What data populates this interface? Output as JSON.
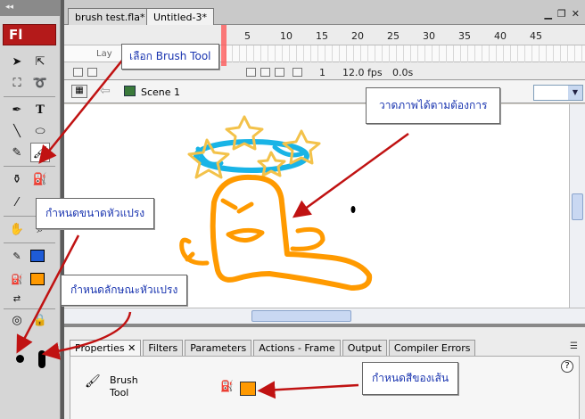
{
  "app": {
    "logo_text": "Fl"
  },
  "document_tabs": [
    {
      "label": "brush test.fla*"
    },
    {
      "label": "Untitled-3*"
    }
  ],
  "timeline": {
    "frame_ticks": [
      "5",
      "10",
      "15",
      "20",
      "25",
      "30",
      "35",
      "40",
      "45"
    ],
    "layer_name": "Lay",
    "current_frame": "1",
    "frame_rate": "12.0 fps",
    "elapsed": "0.0s"
  },
  "scene": {
    "name": "Scene 1"
  },
  "properties": {
    "tabs": [
      "Properties",
      "Filters",
      "Parameters",
      "Actions - Frame",
      "Output",
      "Compiler Errors"
    ],
    "tool_name_line1": "Brush",
    "tool_name_line2": "Tool",
    "help_glyph": "?"
  },
  "colors": {
    "stroke_color": "#1e5bd6",
    "fill_color": "#ff9900",
    "drawing_orange": "#ff9a00",
    "drawing_cyan": "#19b4e6",
    "drawing_yellow": "#f3c24a",
    "arrow_red": "#c01212",
    "callout_text": "#1a35b0"
  },
  "annotations": {
    "select_brush": "เลือก Brush Tool",
    "draw_freely": "วาดภาพได้ตามต้องการ",
    "brush_size": "กำหนดขนาดหัวแปรง",
    "brush_shape": "กำหนดลักษณะหัวแปรง",
    "fill_color": "กำหนดสีของเส้น"
  },
  "icons": [
    "selection-arrow-icon",
    "subselection-icon",
    "free-transform-icon",
    "lasso-icon",
    "pen-icon",
    "text-icon",
    "line-icon",
    "oval-icon",
    "pencil-icon",
    "brush-icon",
    "ink-bottle-icon",
    "paint-bucket-icon",
    "eyedropper-icon",
    "eraser-icon",
    "hand-icon",
    "zoom-icon",
    "swap-colors-icon",
    "lock-fill-icon",
    "help-icon"
  ]
}
